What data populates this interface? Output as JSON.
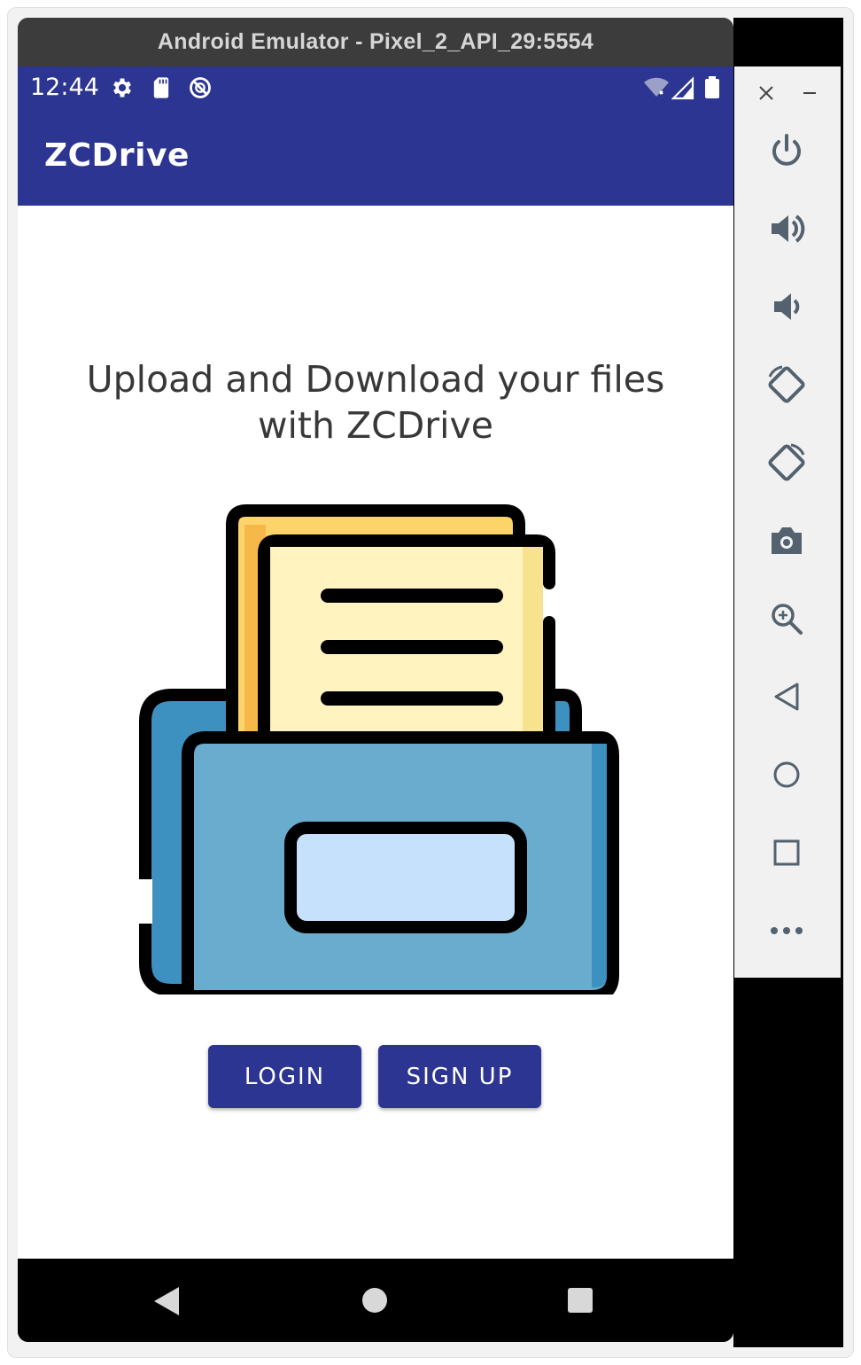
{
  "window": {
    "title": "Android Emulator - Pixel_2_API_29:5554"
  },
  "statusbar": {
    "time": "12:44",
    "icons": [
      "settings-icon",
      "sd-card-icon",
      "sync-blocked-icon",
      "wifi-off-icon",
      "cell-signal-icon",
      "battery-icon"
    ]
  },
  "appbar": {
    "title": "ZCDrive"
  },
  "main": {
    "headline": "Upload and Download your files with ZCDrive",
    "illustration": "file-cabinet-icon"
  },
  "buttons": {
    "login": "LOGIN",
    "signup": "SIGN UP"
  },
  "navbar": {
    "icons": [
      "back-icon",
      "home-icon",
      "recents-icon"
    ]
  },
  "side_panel": {
    "items": [
      "close-icon",
      "minimize-icon",
      "power-icon",
      "volume-up-icon",
      "volume-down-icon",
      "rotate-left-icon",
      "rotate-right-icon",
      "camera-icon",
      "zoom-icon",
      "back-icon",
      "home-icon",
      "overview-icon",
      "more-icon"
    ]
  },
  "colors": {
    "primary": "#2c3591",
    "folder_blue": "#6aaccd",
    "folder_dark": "#3d91c0",
    "paper": "#fff3c0",
    "paper_back": "#fcd46a",
    "label": "#c6e1fb"
  }
}
